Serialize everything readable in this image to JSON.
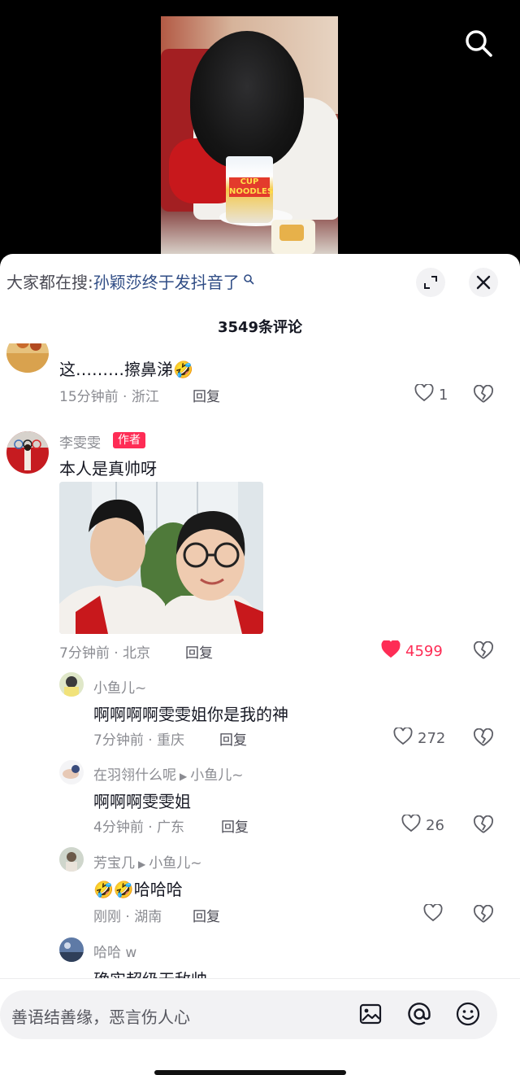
{
  "video": {
    "cup_label": "CUP NOODLES"
  },
  "search_bar": {
    "prefix": "大家都在搜:",
    "trend": "孙颖莎终于发抖音了"
  },
  "comments_header": {
    "count_title": "3549条评论"
  },
  "comments": [
    {
      "text": "这………擦鼻涕🤣",
      "time_location": "15分钟前 · 浙江",
      "reply_label": "回复",
      "likes": "1",
      "liked": false
    },
    {
      "user": "李雯雯",
      "badge": "作者",
      "text": "本人是真帅呀",
      "time_location": "7分钟前 · 北京",
      "reply_label": "回复",
      "likes": "4599",
      "liked": true,
      "replies": [
        {
          "user": "小鱼儿~",
          "text": "啊啊啊啊雯雯姐你是我的神",
          "time_location": "7分钟前 · 重庆",
          "reply_label": "回复",
          "likes": "272"
        },
        {
          "user": "在羽翎什么呢",
          "reply_to": "小鱼儿~",
          "text": "啊啊啊雯雯姐",
          "time_location": "4分钟前 · 广东",
          "reply_label": "回复",
          "likes": "26"
        },
        {
          "user": "芳宝几",
          "reply_to": "小鱼儿~",
          "text": "🤣🤣哈哈哈",
          "time_location": "刚刚 · 湖南",
          "reply_label": "回复",
          "likes": ""
        },
        {
          "user": "哈哈 w",
          "text": "确实超级无敌帅"
        }
      ]
    }
  ],
  "input": {
    "placeholder": "善语结善缘，恶言伤人心"
  },
  "colors": {
    "like_active": "#fe2c55",
    "link": "#2f4c85",
    "badge": "#fe2c55"
  },
  "icons": [
    "search-icon",
    "search-mini-icon",
    "collapse-icon",
    "close-icon",
    "heart-icon",
    "broken-heart-icon",
    "image-icon",
    "at-icon",
    "emoji-icon"
  ]
}
